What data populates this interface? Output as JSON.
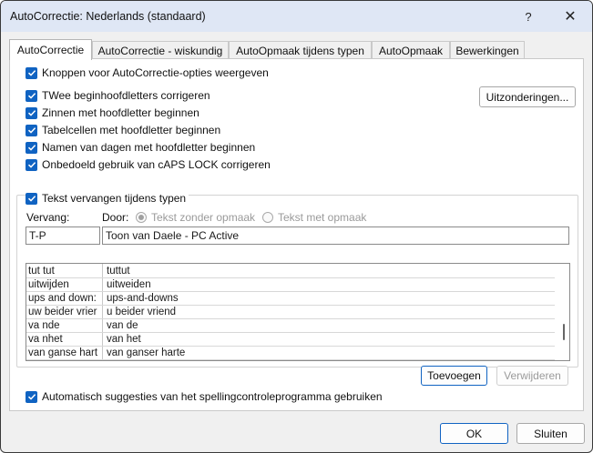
{
  "window": {
    "title": "AutoCorrectie: Nederlands (standaard)",
    "help_glyph": "?",
    "close_glyph": "✕"
  },
  "tabs": [
    {
      "label": "AutoCorrectie",
      "active": true
    },
    {
      "label": "AutoCorrectie - wiskundig",
      "active": false
    },
    {
      "label": "AutoOpmaak tijdens typen",
      "active": false
    },
    {
      "label": "AutoOpmaak",
      "active": false
    },
    {
      "label": "Bewerkingen",
      "active": false
    }
  ],
  "options": {
    "show_buttons": "Knoppen voor AutoCorrectie-opties weergeven",
    "two_initial_caps": "TWee beginhoofdletters corrigeren",
    "sentences_capital": "Zinnen met hoofdletter beginnen",
    "table_cells_capital": "Tabelcellen met hoofdletter beginnen",
    "day_names_capital": "Namen van dagen met hoofdletter beginnen",
    "caps_lock": "Onbedoeld gebruik van cAPS LOCK corrigeren",
    "replace_text": "Tekst vervangen tijdens typen",
    "auto_suggestions": "Automatisch suggesties van het spellingcontroleprogramma gebruiken"
  },
  "buttons": {
    "exceptions": "Uitzonderingen...",
    "add": "Toevoegen",
    "remove": "Verwijderen",
    "ok": "OK",
    "close": "Sluiten"
  },
  "replace": {
    "replace_label": "Vervang:",
    "with_label": "Door:",
    "plain_text": "Tekst zonder opmaak",
    "formatted_text": "Tekst met opmaak",
    "replace_value": "T-P",
    "with_value": "Toon van Daele - PC Active"
  },
  "entries": [
    {
      "from": "tut tut",
      "to": "tuttut"
    },
    {
      "from": "uitwijden",
      "to": "uitweiden"
    },
    {
      "from": "ups and down:",
      "to": "ups-and-downs"
    },
    {
      "from": "uw beider vrier",
      "to": "u beider vriend"
    },
    {
      "from": "va nde",
      "to": "van de"
    },
    {
      "from": "va nhet",
      "to": "van het"
    },
    {
      "from": "van ganse hart",
      "to": "van ganser harte"
    }
  ],
  "colors": {
    "accent": "#1063c2",
    "titlebar": "#dfe7f5"
  }
}
